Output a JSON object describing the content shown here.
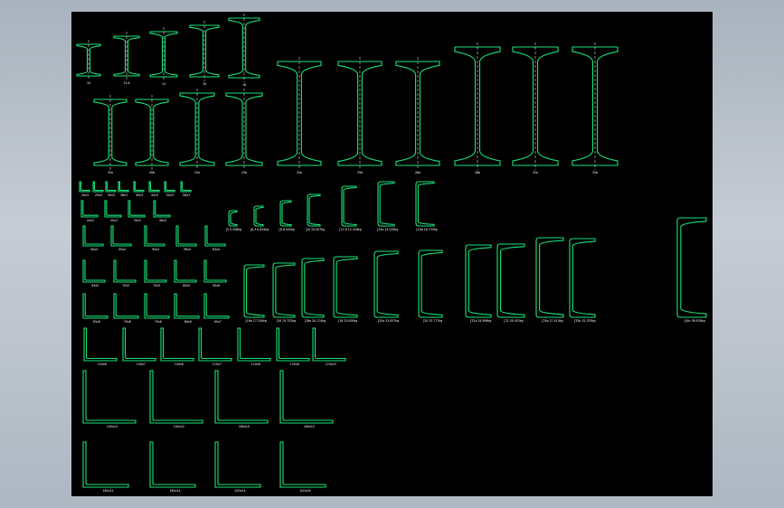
{
  "colors": {
    "background": "#000000",
    "profile": "#19e37a",
    "centerline": "#ffffff",
    "window": "#b7c0ca"
  },
  "drawing": {
    "i_beam_labels": [
      "10",
      "12.6",
      "14",
      "16",
      "18",
      "20a",
      "20b",
      "22a",
      "22b",
      "25a",
      "25b",
      "28a",
      "28b",
      "32a",
      "32b",
      "32c"
    ],
    "channel_labels": [
      "[5 5.438kg",
      "[6.3 6.634kg",
      "[8 8.045kg",
      "[10 10.007kg",
      "[12.6 12.318kg",
      "[14a 14.535kg",
      "[14b 16.733kg",
      "[16a 17.240kg",
      "[16 19.752kg",
      "[18a 20.174kg",
      "[18 23.000kg",
      "[20a 22.637kg",
      "[20 25.777kg",
      "[22a 24.999kg",
      "[22 28.453kg",
      "[25a 27.410kg",
      "[25b 31.335kg",
      "[28a 31.427kg",
      "[40c 58.928kg"
    ],
    "small_angle_labels": [
      "20x3",
      "25x3",
      "30x3",
      "36x3",
      "40x3",
      "45x3",
      "50x3",
      "56x3"
    ],
    "angle_labels": [
      "40x4",
      "45x4",
      "50x4",
      "56x4",
      "63x4",
      "63x5",
      "70x5",
      "75x5",
      "80x5",
      "90x6",
      "63x6",
      "70x6",
      "75x6",
      "80x6",
      "90x7",
      "100x6",
      "100x7",
      "100x8",
      "110x7",
      "110x8",
      "125x8",
      "125x10",
      "140x10",
      "140x12",
      "160x10",
      "160x12",
      "180x12",
      "180x14",
      "200x14",
      "200x16"
    ]
  }
}
